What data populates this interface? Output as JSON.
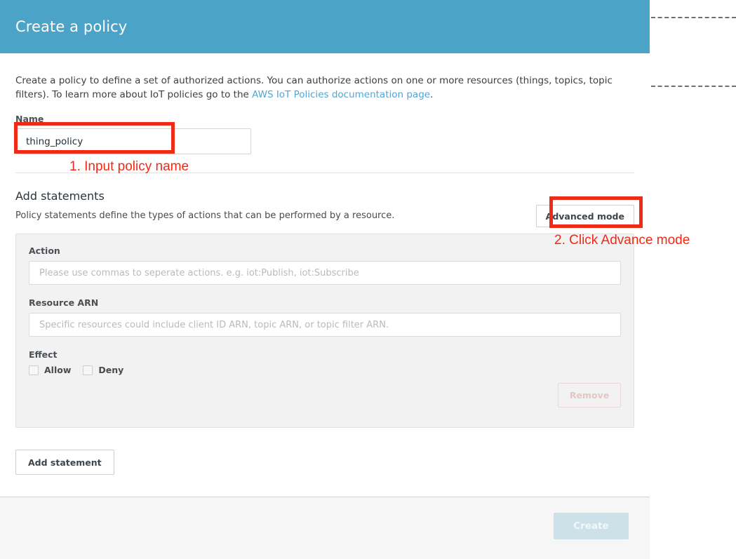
{
  "modal": {
    "title": "Create a policy",
    "intro": {
      "text_before": "Create a policy to define a set of authorized actions. You can authorize actions on one or more resources (things, topics, topic filters). To learn more about IoT policies go to the ",
      "link_text": "AWS IoT Policies documentation page",
      "text_after": "."
    },
    "name_field": {
      "label": "Name",
      "value": "thing_policy",
      "placeholder": ""
    },
    "statements_section": {
      "title": "Add statements",
      "subtitle": "Policy statements define the types of actions that can be performed by a resource.",
      "advanced_mode_label": "Advanced mode"
    },
    "statement": {
      "action_label": "Action",
      "action_value": "",
      "action_placeholder": "Please use commas to seperate actions. e.g. iot:Publish, iot:Subscribe",
      "resource_label": "Resource ARN",
      "resource_value": "",
      "resource_placeholder": "Specific resources could include client ID ARN, topic ARN, or topic filter ARN.",
      "effect_label": "Effect",
      "allow_label": "Allow",
      "deny_label": "Deny",
      "remove_label": "Remove"
    },
    "add_statement_label": "Add statement",
    "footer": {
      "create_label": "Create"
    }
  },
  "annotations": [
    {
      "id": "step-1",
      "text": "1. Input policy name"
    },
    {
      "id": "step-2",
      "text": "2. Click Advance mode"
    }
  ],
  "colors": {
    "header_blue": "#4ba3c7",
    "link_blue": "#53a5d4",
    "annotation_red": "#ef2b18",
    "card_gray": "#f2f2f2",
    "footer_gray": "#f6f6f6",
    "create_disabled": "#cde1e9"
  }
}
